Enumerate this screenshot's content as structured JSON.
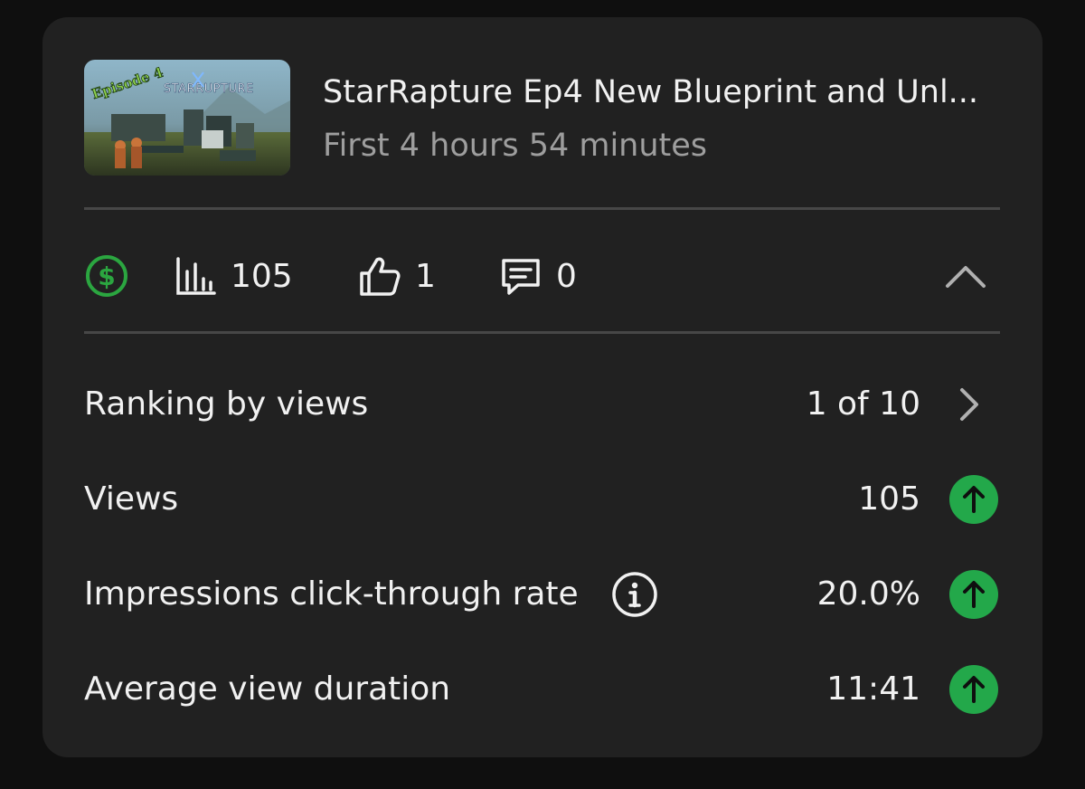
{
  "video": {
    "title": "StarRapture Ep4 New Blueprint and Unl...",
    "subtitle": "First 4 hours 54 minutes",
    "thumbnail": {
      "episode_text": "Episode 4",
      "logo_text": "STARRUPTURE"
    }
  },
  "stats": {
    "monetization_icon": "dollar-circle-icon",
    "views": "105",
    "likes": "1",
    "comments": "0"
  },
  "metrics": [
    {
      "label": "Ranking by views",
      "value": "1 of 10",
      "icon": "chevron-right-icon"
    },
    {
      "label": "Views",
      "value": "105",
      "icon": "trend-up-icon"
    },
    {
      "label": "Impressions click-through rate",
      "value": "20.0%",
      "icon": "trend-up-icon",
      "has_info": true
    },
    {
      "label": "Average view duration",
      "value": "11:41",
      "icon": "trend-up-icon"
    }
  ],
  "colors": {
    "background": "#0f0f0f",
    "card": "#212121",
    "accent_green": "#23a84a",
    "monetization_green": "#2ba640",
    "text_primary": "#f1f1f1",
    "text_secondary": "#9e9e9e"
  }
}
